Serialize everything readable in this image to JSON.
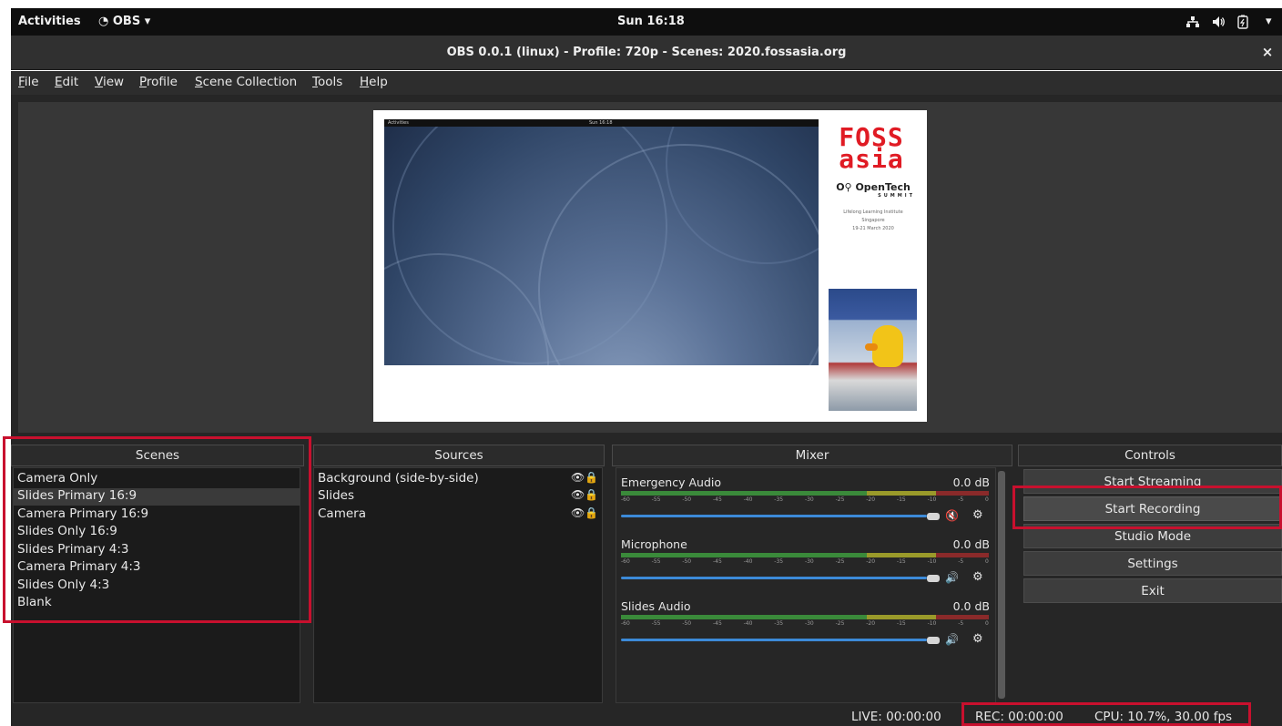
{
  "topbar": {
    "activities": "Activities",
    "app_menu": "OBS",
    "clock": "Sun 16:18"
  },
  "window": {
    "title": "OBS 0.0.1 (linux) - Profile: 720p - Scenes: 2020.fossasia.org",
    "close": "×"
  },
  "menu": [
    {
      "key": "F",
      "rest": "ile"
    },
    {
      "key": "E",
      "rest": "dit"
    },
    {
      "key": "V",
      "rest": "iew"
    },
    {
      "key": "P",
      "rest": "rofile"
    },
    {
      "key": "S",
      "rest": "cene Collection"
    },
    {
      "key": "T",
      "rest": "ools"
    },
    {
      "key": "H",
      "rest": "elp"
    }
  ],
  "preview": {
    "desktop_left": "Activities",
    "desktop_clock": "Sun 16:18",
    "logo_line1": "FOSS",
    "logo_line2": "asia",
    "opentech": "OpenTech",
    "summit": "SUMMIT",
    "venue": "Lifelong Learning Institute",
    "city": "Singapore",
    "dates": "19-21 March 2020"
  },
  "docks": {
    "scenes": "Scenes",
    "sources": "Sources",
    "mixer": "Mixer",
    "controls": "Controls"
  },
  "scenes": [
    "Camera Only",
    "Slides Primary 16:9",
    "Camera Primary 16:9",
    "Slides Only 16:9",
    "Slides Primary 4:3",
    "Camera Primary 4:3",
    "Slides Only 4:3",
    "Blank"
  ],
  "selected_scene": "Slides Primary 16:9",
  "sources": [
    "Background (side-by-side)",
    "Slides",
    "Camera"
  ],
  "source_icons": [
    "eye-icon",
    "lock-icon"
  ],
  "mixer": [
    {
      "name": "Emergency Audio",
      "db": "0.0 dB",
      "muted": true
    },
    {
      "name": "Microphone",
      "db": "0.0 dB",
      "muted": false
    },
    {
      "name": "Slides Audio",
      "db": "0.0 dB",
      "muted": false
    }
  ],
  "meter_ticks": [
    "-60",
    "-55",
    "-50",
    "-45",
    "-40",
    "-35",
    "-30",
    "-25",
    "-20",
    "-15",
    "-10",
    "-5",
    "0"
  ],
  "controls": {
    "streaming": "Start Streaming",
    "recording": "Start Recording",
    "studio": "Studio Mode",
    "settings": "Settings",
    "exit": "Exit"
  },
  "status": {
    "live": "LIVE: 00:00:00",
    "rec": "REC: 00:00:00",
    "cpu": "CPU: 10.7%, 30.00 fps"
  },
  "colors": {
    "highlight": "#c8102e",
    "slider_accent": "#3c8ad8",
    "meter_green": "#3a8a3a",
    "meter_yellow": "#9a9a2a",
    "meter_red": "#8a2a2a"
  }
}
